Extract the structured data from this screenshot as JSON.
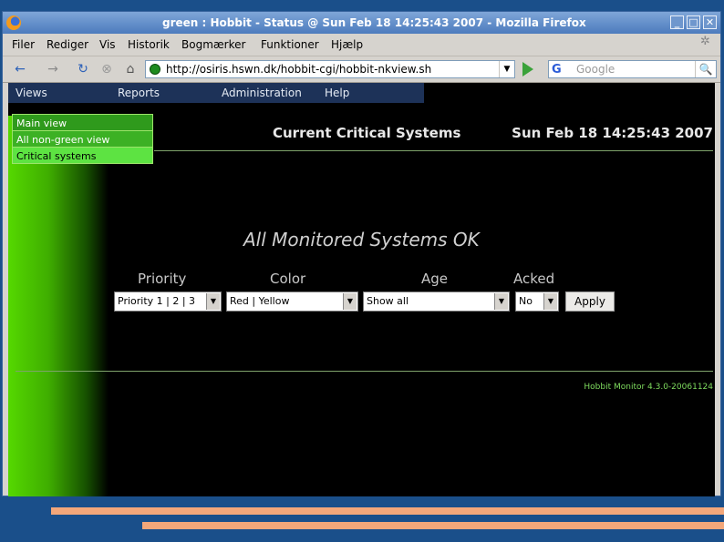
{
  "window": {
    "title": "green : Hobbit - Status @ Sun Feb 18 14:25:43 2007 - Mozilla Firefox",
    "controls": {
      "minimize": "_",
      "maximize": "□",
      "close": "✕"
    }
  },
  "menubar": {
    "items": [
      "Filer",
      "Rediger",
      "Vis",
      "Historik",
      "Bogmærker",
      "Funktioner",
      "Hjælp"
    ]
  },
  "navbar": {
    "back": "←",
    "forward": "→",
    "reload": "↻",
    "stop": "⊗",
    "home": "⌂",
    "url": "http://osiris.hswn.dk/hobbit-cgi/hobbit-nkview.sh",
    "search_engine": "G",
    "search_placeholder": "Google",
    "search_icon": "🔍"
  },
  "page": {
    "menu": [
      "Views",
      "Reports",
      "Administration",
      "Help"
    ],
    "views_dropdown": [
      "Main view",
      "All non-green view",
      "Critical systems"
    ],
    "header_title": "Current Critical Systems",
    "header_date": "Sun Feb 18 14:25:43 2007",
    "status_message": "All Monitored Systems OK",
    "filters": {
      "priority_label": "Priority",
      "priority_value": "Priority 1 | 2 | 3",
      "color_label": "Color",
      "color_value": "Red | Yellow",
      "age_label": "Age",
      "age_value": "Show all",
      "acked_label": "Acked",
      "acked_value": "No",
      "apply_label": "Apply"
    },
    "footer": "Hobbit Monitor 4.3.0-20061124"
  },
  "colors": {
    "page_background": "#000000",
    "accent_green": "#5de342",
    "desktop": "#1a4f8a",
    "desktop_bars": "#f3a77a"
  }
}
